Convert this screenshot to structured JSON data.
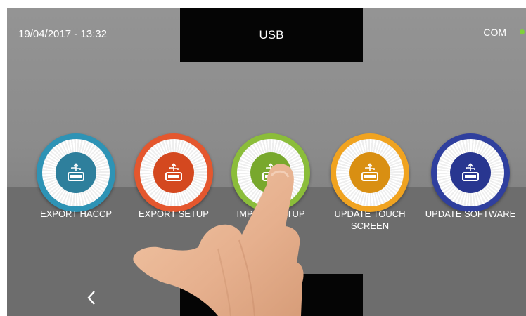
{
  "header": {
    "title": "USB",
    "datetime": "19/04/2017 - 13:32",
    "status_label": "COM",
    "status_color": "#7fd13b"
  },
  "buttons": [
    {
      "label": "EXPORT HACCP",
      "color": "#2e93b5",
      "icon": "usb-drive-icon"
    },
    {
      "label": "EXPORT SETUP",
      "color": "#e4572e",
      "icon": "usb-drive-icon"
    },
    {
      "label": "IMPORT SETUP",
      "color": "#8bbd3a",
      "icon": "usb-drive-icon"
    },
    {
      "label": "UPDATE TOUCH SCREEN",
      "color": "#f0a320",
      "icon": "usb-drive-icon"
    },
    {
      "label": "UPDATE SOFTWARE",
      "color": "#2f3f9e",
      "icon": "usb-drive-icon"
    }
  ],
  "footer": {
    "back_icon": "chevron-left-icon",
    "home_icon": "home-icon"
  }
}
